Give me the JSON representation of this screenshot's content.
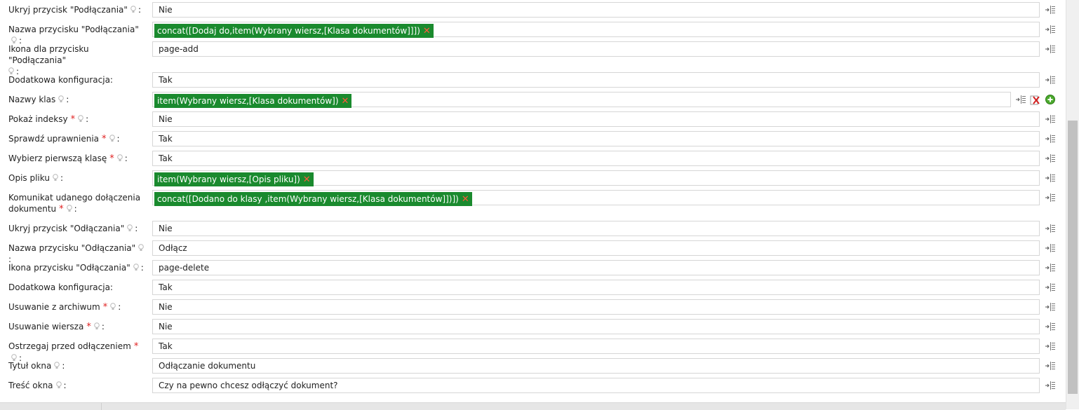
{
  "rows": [
    {
      "label": "Ukryj przycisk \"Podłączania\"",
      "required": false,
      "value": "Nie"
    },
    {
      "label": "Nazwa przycisku \"Podłączania\"",
      "required": false,
      "tag": "concat([Dodaj do,item(Wybrany wiersz,[Klasa dokumentów]]])"
    },
    {
      "label": "Ikona dla przycisku \"Podłączania\"",
      "required": false,
      "value": "page-add"
    },
    {
      "label": "Dodatkowa konfiguracja:",
      "value": "Tak"
    },
    {
      "label": "Nazwy klas",
      "required": false,
      "tag": "item(Wybrany wiersz,[Klasa dokumentów])"
    },
    {
      "label": "Pokaż indeksy",
      "required": true,
      "value": "Nie"
    },
    {
      "label": "Sprawdź uprawnienia",
      "required": true,
      "value": "Tak"
    },
    {
      "label": "Wybierz pierwszą klasę",
      "required": true,
      "value": "Tak"
    },
    {
      "label": "Opis pliku",
      "required": false,
      "tag": "item(Wybrany wiersz,[Opis pliku])"
    },
    {
      "label_line1": "Komunikat udanego dołączenia",
      "label_line2": "dokumentu",
      "required": true,
      "tag": "concat([Dodano do klasy ,item(Wybrany wiersz,[Klasa dokumentów]])])"
    },
    {
      "label": "Ukryj przycisk \"Odłączania\"",
      "required": false,
      "value": "Nie"
    },
    {
      "label": "Nazwa przycisku \"Odłączania\"",
      "required": false,
      "value": "Odłącz"
    },
    {
      "label": "Ikona przycisku \"Odłączania\"",
      "required": false,
      "value": "page-delete"
    },
    {
      "label": "Dodatkowa konfiguracja:",
      "value": "Tak"
    },
    {
      "label": "Usuwanie z archiwum",
      "required": true,
      "value": "Nie"
    },
    {
      "label": "Usuwanie wiersza",
      "required": true,
      "value": "Nie"
    },
    {
      "label": "Ostrzegaj przed odłączeniem",
      "required": true,
      "value": "Tak"
    },
    {
      "label": "Tytuł okna",
      "required": false,
      "value": "Odłączanie dokumentu"
    },
    {
      "label": "Treść okna",
      "required": false,
      "value": "Czy na pewno chcesz odłączyć dokument?"
    }
  ],
  "symbols": {
    "required": "*",
    "colon": ":",
    "remove": "✕"
  },
  "colors": {
    "tag_bg": "#1a8a2e",
    "required": "#e02020",
    "remove": "#ff5a3c"
  },
  "icons": [
    "lightbulb-hint-icon",
    "expression-editor-icon",
    "clear-icon",
    "add-icon"
  ]
}
